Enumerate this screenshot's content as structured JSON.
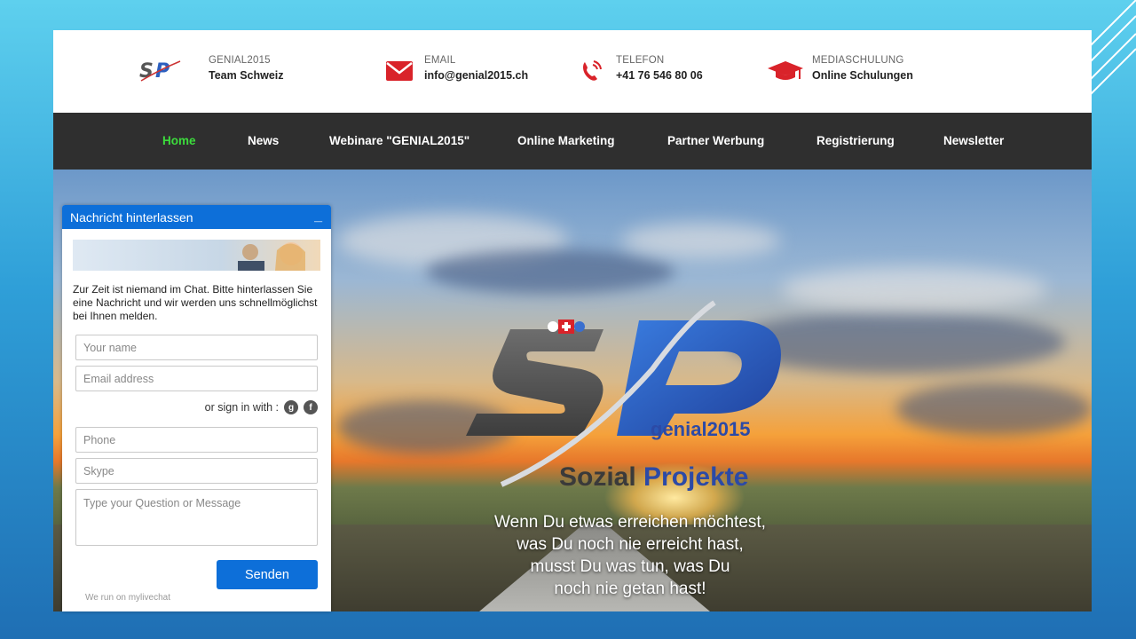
{
  "header": {
    "logo_text": "SP",
    "items": [
      {
        "label": "GENIAL2015",
        "value": "Team Schweiz"
      },
      {
        "label": "EMAIL",
        "value": "info@genial2015.ch"
      },
      {
        "label": "TELEFON",
        "value": "+41 76 546 80 06"
      },
      {
        "label": "MEDIASCHULUNG",
        "value": "Online Schulungen"
      }
    ]
  },
  "nav": {
    "items": [
      "Home",
      "News",
      "Webinare \"GENIAL2015\"",
      "Online Marketing",
      "Partner Werbung",
      "Registrierung",
      "Newsletter"
    ],
    "active": "Home"
  },
  "hero": {
    "brand_small": "genial2015",
    "brand_title_part1": "Sozial",
    "brand_title_part2": "Projekte",
    "tagline": [
      "Wenn Du etwas erreichen möchtest,",
      "was Du noch nie erreicht hast,",
      "musst Du was tun, was Du",
      "noch nie getan hast!"
    ]
  },
  "chat": {
    "title": "Nachricht hinterlassen",
    "minimize": "_",
    "message": "Zur Zeit ist niemand im Chat. Bitte hinterlassen Sie eine Nachricht und wir werden uns schnellmöglichst bei Ihnen melden.",
    "name_placeholder": "Your name",
    "email_placeholder": "Email address",
    "signin_text": "or sign in with :",
    "phone_placeholder": "Phone",
    "skype_placeholder": "Skype",
    "message_placeholder": "Type your Question or Message",
    "send_label": "Senden",
    "powered_by": "We run on mylivechat"
  },
  "colors": {
    "nav_bg": "#2f2f2f",
    "nav_active": "#3cdc3c",
    "chat_blue": "#0d6fd9",
    "icon_red": "#d9232a"
  }
}
